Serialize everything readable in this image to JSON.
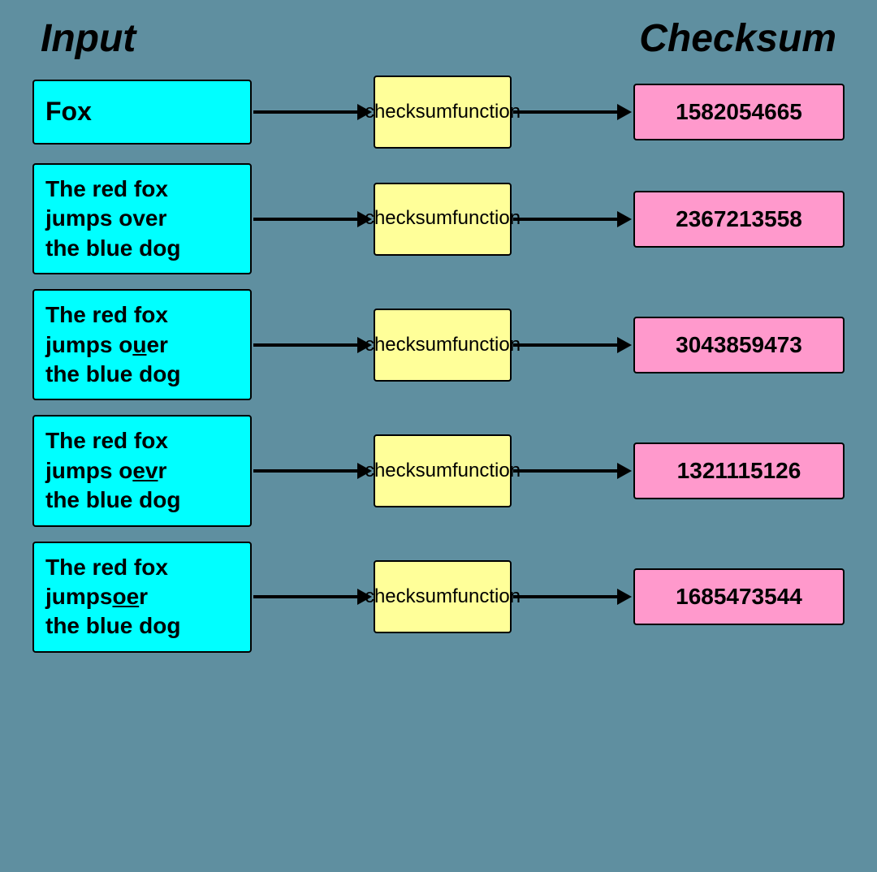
{
  "header": {
    "left_title": "Input",
    "right_title": "Checksum"
  },
  "rows": [
    {
      "id": "row-1",
      "input_text_plain": "Fox",
      "input_html": "Fox",
      "function_label": "checksum\nfunction",
      "output_value": "1582054665"
    },
    {
      "id": "row-2",
      "input_text_plain": "The red fox\njumps over\nthe blue dog",
      "input_html": "The red fox\njumps over\nthe blue dog",
      "function_label": "checksum\nfunction",
      "output_value": "2367213558"
    },
    {
      "id": "row-3",
      "input_text_plain": "The red fox\njumps ouer\nthe blue dog",
      "input_html": "The red fox<br>jumps o<b><u>u</u></b>er<br>the blue dog",
      "function_label": "checksum\nfunction",
      "output_value": "3043859473"
    },
    {
      "id": "row-4",
      "input_text_plain": "The red fox\njumps oevr\nthe blue dog",
      "input_html": "The red fox<br>jumps o<b><u>ev</u></b>r<br>the blue dog",
      "function_label": "checksum\nfunction",
      "output_value": "1321115126"
    },
    {
      "id": "row-5",
      "input_text_plain": "The red fox\njumpsoer\nthe blue dog",
      "input_html": "The red fox<br>jumps<b><u>oe</u></b>r<br>the blue dog",
      "function_label": "checksum\nfunction",
      "output_value": "1685473544"
    }
  ]
}
